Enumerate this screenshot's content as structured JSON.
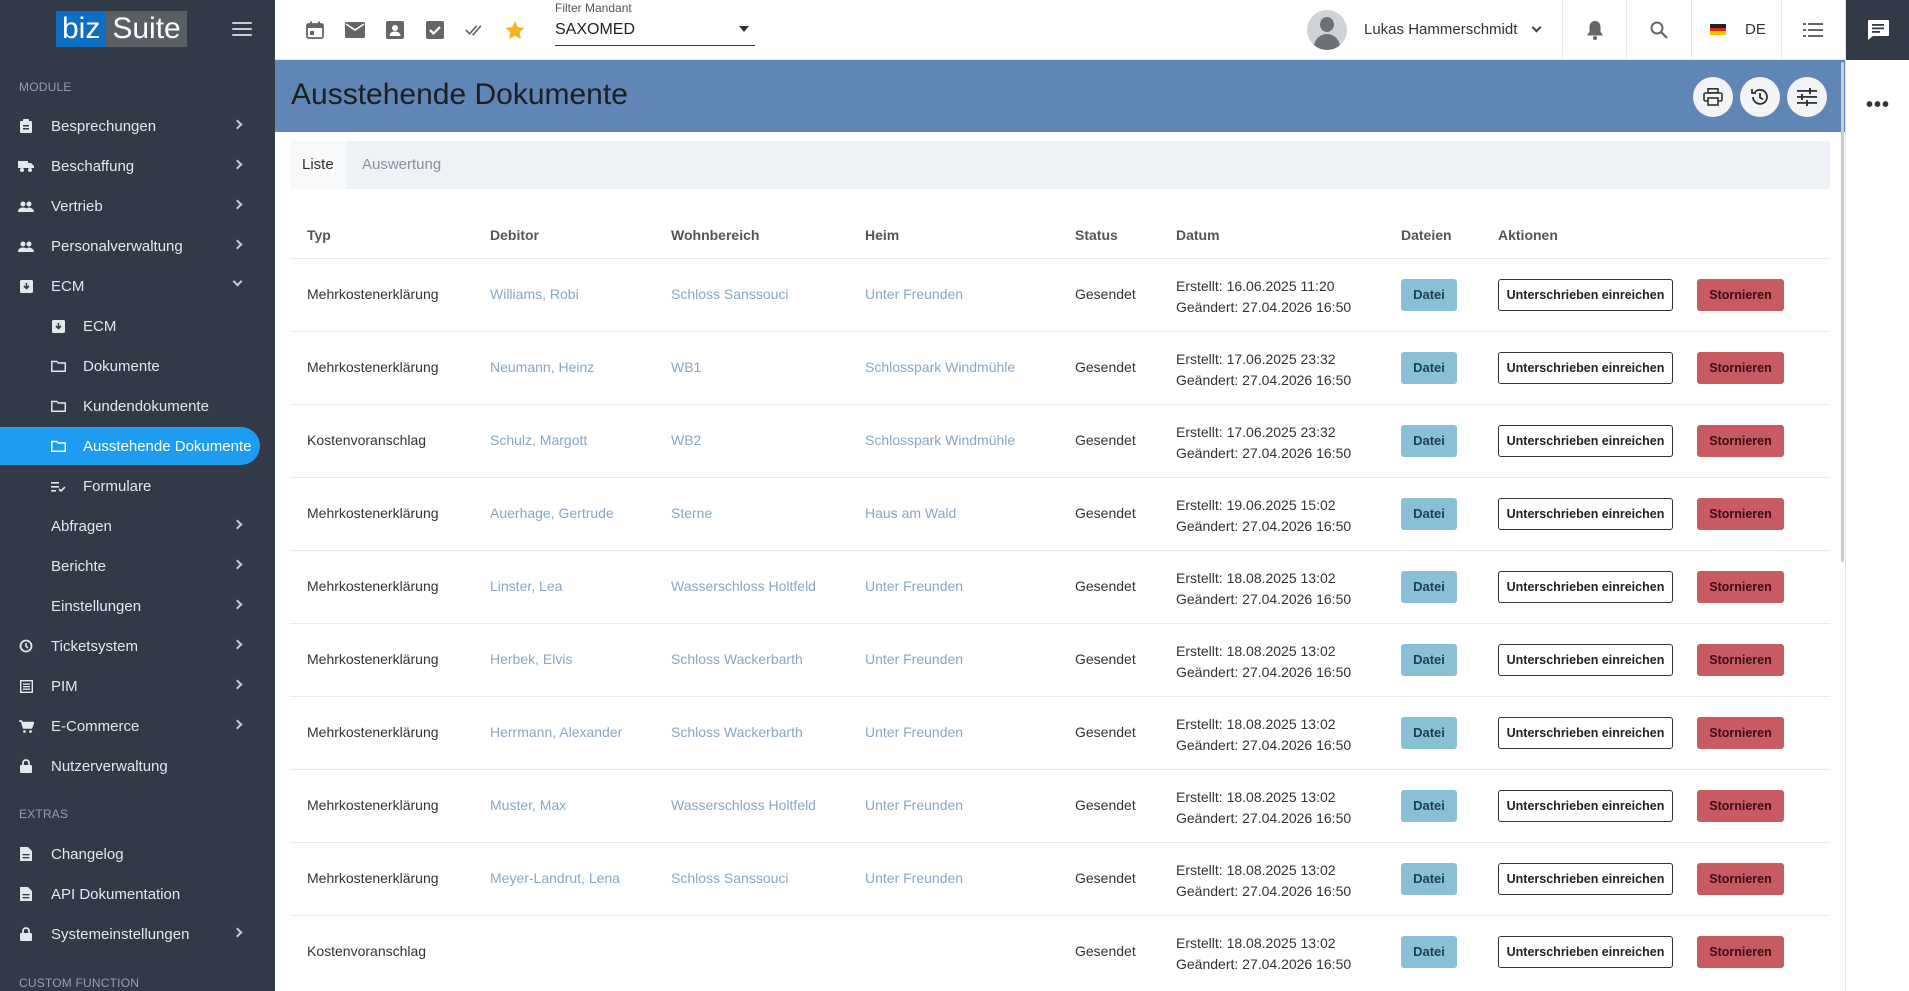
{
  "app": {
    "logo_biz": "biz",
    "logo_suite": "Suite"
  },
  "sidebar": {
    "section_module": "MODULE",
    "section_extras": "EXTRAS",
    "section_custom": "CUSTOM FUNCTION",
    "items": [
      {
        "label": "Besprechungen",
        "icon": "clipboard-icon"
      },
      {
        "label": "Beschaffung",
        "icon": "truck-icon"
      },
      {
        "label": "Vertrieb",
        "icon": "people-icon"
      },
      {
        "label": "Personalverwaltung",
        "icon": "people-icon"
      },
      {
        "label": "ECM",
        "icon": "archive-icon"
      },
      {
        "label": "ECM",
        "icon": "archive-icon"
      },
      {
        "label": "Dokumente",
        "icon": "folder-icon"
      },
      {
        "label": "Kundendokumente",
        "icon": "folder-icon"
      },
      {
        "label": "Ausstehende Dokumente",
        "icon": "folder-icon"
      },
      {
        "label": "Formulare",
        "icon": "list-check-icon"
      },
      {
        "label": "Abfragen"
      },
      {
        "label": "Berichte"
      },
      {
        "label": "Einstellungen"
      },
      {
        "label": "Ticketsystem",
        "icon": "ticket-icon"
      },
      {
        "label": "PIM",
        "icon": "list-icon"
      },
      {
        "label": "E-Commerce",
        "icon": "cart-icon"
      },
      {
        "label": "Nutzerverwaltung",
        "icon": "lock-icon"
      },
      {
        "label": "Changelog",
        "icon": "document-icon"
      },
      {
        "label": "API Dokumentation",
        "icon": "document-icon"
      },
      {
        "label": "Systemeinstellungen",
        "icon": "lock-icon"
      }
    ]
  },
  "topbar": {
    "filter_label": "Filter Mandant",
    "filter_value": "SAXOMED",
    "user_name": "Lukas Hammerschmidt",
    "language": "DE"
  },
  "page": {
    "title": "Ausstehende Dokumente",
    "tabs": [
      "Liste",
      "Auswertung"
    ]
  },
  "table": {
    "headers": [
      "Typ",
      "Debitor",
      "Wohnbereich",
      "Heim",
      "Status",
      "Datum",
      "Dateien",
      "Aktionen"
    ],
    "button_datei": "Datei",
    "button_sign": "Unterschrieben einreichen",
    "button_cancel": "Stornieren",
    "rows": [
      {
        "typ": "Mehrkostenerklärung",
        "debitor": "Williams, Robi",
        "wohnbereich": "Schloss Sanssouci",
        "heim": "Unter Freunden",
        "status": "Gesendet",
        "erstellt": "Erstellt: 16.06.2025 11:20",
        "geaendert": "Geändert: 27.04.2026 16:50"
      },
      {
        "typ": "Mehrkostenerklärung",
        "debitor": "Neumann, Heinz",
        "wohnbereich": "WB1",
        "heim": "Schlosspark Windmühle",
        "status": "Gesendet",
        "erstellt": "Erstellt: 17.06.2025 23:32",
        "geaendert": "Geändert: 27.04.2026 16:50"
      },
      {
        "typ": "Kostenvoranschlag",
        "debitor": "Schulz, Margott",
        "wohnbereich": "WB2",
        "heim": "Schlosspark Windmühle",
        "status": "Gesendet",
        "erstellt": "Erstellt: 17.06.2025 23:32",
        "geaendert": "Geändert: 27.04.2026 16:50"
      },
      {
        "typ": "Mehrkostenerklärung",
        "debitor": "Auerhage, Gertrude",
        "wohnbereich": "Sterne",
        "heim": "Haus am Wald",
        "status": "Gesendet",
        "erstellt": "Erstellt: 19.06.2025 15:02",
        "geaendert": "Geändert: 27.04.2026 16:50"
      },
      {
        "typ": "Mehrkostenerklärung",
        "debitor": "Linster, Lea",
        "wohnbereich": "Wasserschloss Holtfeld",
        "heim": "Unter Freunden",
        "status": "Gesendet",
        "erstellt": "Erstellt: 18.08.2025 13:02",
        "geaendert": "Geändert: 27.04.2026 16:50"
      },
      {
        "typ": "Mehrkostenerklärung",
        "debitor": "Herbek, Elvis",
        "wohnbereich": "Schloss Wackerbarth",
        "heim": "Unter Freunden",
        "status": "Gesendet",
        "erstellt": "Erstellt: 18.08.2025 13:02",
        "geaendert": "Geändert: 27.04.2026 16:50"
      },
      {
        "typ": "Mehrkostenerklärung",
        "debitor": "Herrmann, Alexander",
        "wohnbereich": "Schloss Wackerbarth",
        "heim": "Unter Freunden",
        "status": "Gesendet",
        "erstellt": "Erstellt: 18.08.2025 13:02",
        "geaendert": "Geändert: 27.04.2026 16:50"
      },
      {
        "typ": "Mehrkostenerklärung",
        "debitor": "Muster, Max",
        "wohnbereich": "Wasserschloss Holtfeld",
        "heim": "Unter Freunden",
        "status": "Gesendet",
        "erstellt": "Erstellt: 18.08.2025 13:02",
        "geaendert": "Geändert: 27.04.2026 16:50"
      },
      {
        "typ": "Mehrkostenerklärung",
        "debitor": "Meyer-Landrut, Lena",
        "wohnbereich": "Schloss Sanssouci",
        "heim": "Unter Freunden",
        "status": "Gesendet",
        "erstellt": "Erstellt: 18.08.2025 13:02",
        "geaendert": "Geändert: 27.04.2026 16:50"
      },
      {
        "typ": "Kostenvoranschlag",
        "debitor": "",
        "wohnbereich": "",
        "heim": "",
        "status": "Gesendet",
        "erstellt": "Erstellt: 18.08.2025 13:02",
        "geaendert": "Geändert: 27.04.2026 16:50"
      }
    ]
  },
  "colors": {
    "sidebar_bg": "#313a46",
    "active": "#1e9df0",
    "header_band": "#5f86b4",
    "datei_btn": "#89c0d6",
    "cancel_btn": "#c85a62",
    "link": "#8aa7c2"
  }
}
